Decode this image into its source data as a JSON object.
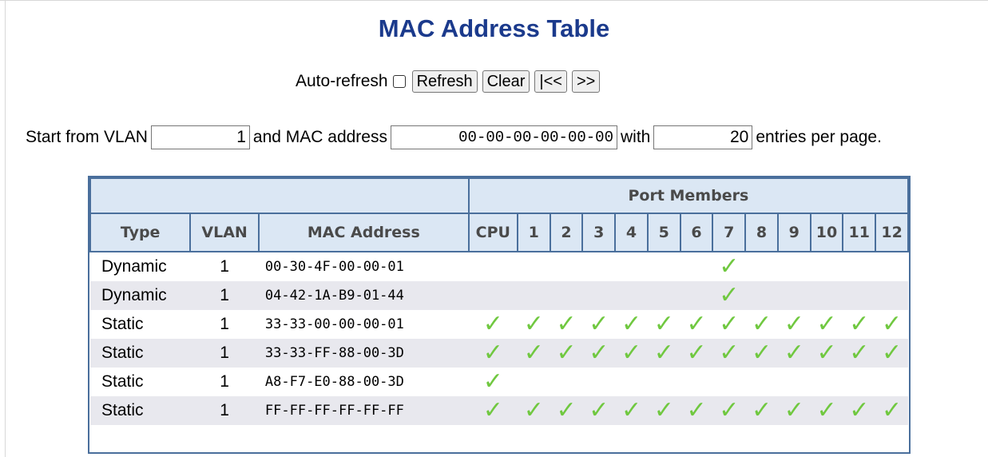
{
  "title": "MAC Address Table",
  "controls": {
    "auto_refresh_label": "Auto-refresh",
    "refresh_label": "Refresh",
    "clear_label": "Clear",
    "first_label": "|<<",
    "next_label": ">>"
  },
  "filter": {
    "start_label": "Start from VLAN",
    "vlan_value": "1",
    "and_mac_label": "and MAC address",
    "mac_value": "00-00-00-00-00-00",
    "with_label": "with",
    "entries_value": "20",
    "entries_suffix": "entries per page."
  },
  "table": {
    "group_header": "Port Members",
    "headers": {
      "type": "Type",
      "vlan": "VLAN",
      "mac": "MAC Address",
      "ports": [
        "CPU",
        "1",
        "2",
        "3",
        "4",
        "5",
        "6",
        "7",
        "8",
        "9",
        "10",
        "11",
        "12"
      ]
    },
    "check_glyph": "✓",
    "check_color": "#70c840",
    "rows": [
      {
        "type": "Dynamic",
        "vlan": "1",
        "mac": "00-30-4F-00-00-01",
        "members": [
          0,
          0,
          0,
          0,
          0,
          0,
          0,
          1,
          0,
          0,
          0,
          0,
          0
        ]
      },
      {
        "type": "Dynamic",
        "vlan": "1",
        "mac": "04-42-1A-B9-01-44",
        "members": [
          0,
          0,
          0,
          0,
          0,
          0,
          0,
          1,
          0,
          0,
          0,
          0,
          0
        ]
      },
      {
        "type": "Static",
        "vlan": "1",
        "mac": "33-33-00-00-00-01",
        "members": [
          1,
          1,
          1,
          1,
          1,
          1,
          1,
          1,
          1,
          1,
          1,
          1,
          1
        ]
      },
      {
        "type": "Static",
        "vlan": "1",
        "mac": "33-33-FF-88-00-3D",
        "members": [
          1,
          1,
          1,
          1,
          1,
          1,
          1,
          1,
          1,
          1,
          1,
          1,
          1
        ]
      },
      {
        "type": "Static",
        "vlan": "1",
        "mac": "A8-F7-E0-88-00-3D",
        "members": [
          1,
          0,
          0,
          0,
          0,
          0,
          0,
          0,
          0,
          0,
          0,
          0,
          0
        ]
      },
      {
        "type": "Static",
        "vlan": "1",
        "mac": "FF-FF-FF-FF-FF-FF",
        "members": [
          1,
          1,
          1,
          1,
          1,
          1,
          1,
          1,
          1,
          1,
          1,
          1,
          1
        ]
      }
    ]
  }
}
